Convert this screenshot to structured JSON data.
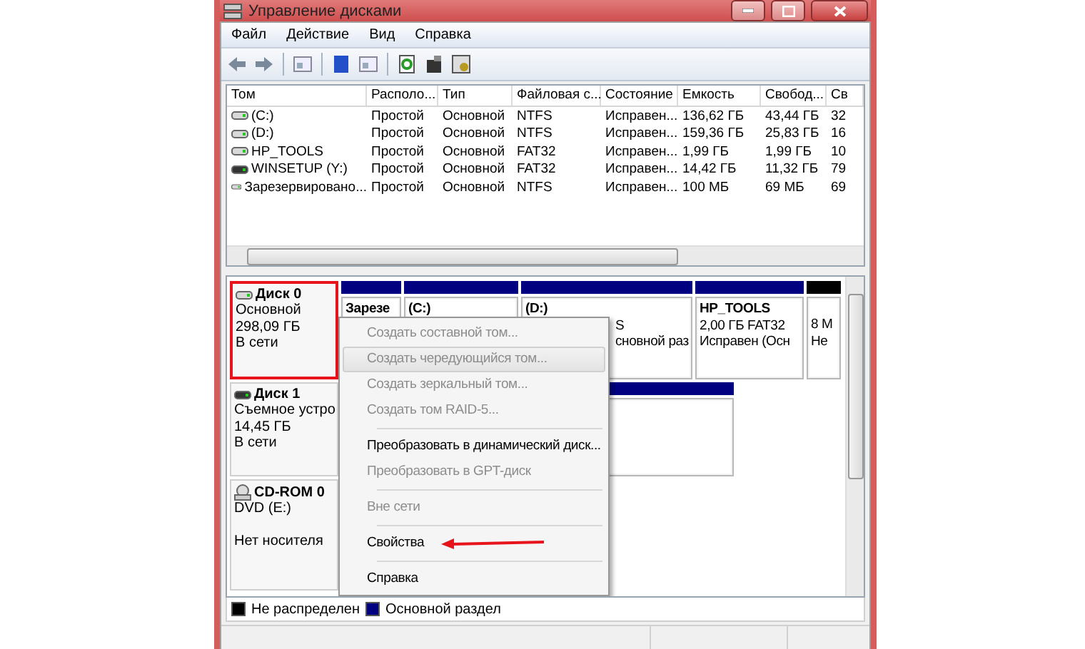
{
  "window": {
    "title": "Управление дисками"
  },
  "menu": [
    "Файл",
    "Действие",
    "Вид",
    "Справка"
  ],
  "table": {
    "columns": [
      "Том",
      "Располо...",
      "Тип",
      "Файловая с...",
      "Состояние",
      "Емкость",
      "Свобод...",
      "Св"
    ],
    "rows": [
      {
        "kind": "disk",
        "cells": [
          "(C:)",
          "Простой",
          "Основной",
          "NTFS",
          "Исправен...",
          "136,62 ГБ",
          "43,44 ГБ",
          "32"
        ]
      },
      {
        "kind": "disk",
        "cells": [
          "(D:)",
          "Простой",
          "Основной",
          "NTFS",
          "Исправен...",
          "159,36 ГБ",
          "25,83 ГБ",
          "16"
        ]
      },
      {
        "kind": "disk",
        "cells": [
          "HP_TOOLS",
          "Простой",
          "Основной",
          "FAT32",
          "Исправен...",
          "1,99 ГБ",
          "1,99 ГБ",
          "10"
        ]
      },
      {
        "kind": "removable",
        "cells": [
          "WINSETUP (Y:)",
          "Простой",
          "Основной",
          "FAT32",
          "Исправен...",
          "14,42 ГБ",
          "11,32 ГБ",
          "79"
        ]
      },
      {
        "kind": "disk",
        "cells": [
          "Зарезервировано...",
          "Простой",
          "Основной",
          "NTFS",
          "Исправен...",
          "100 МБ",
          "69 МБ",
          "69"
        ]
      }
    ]
  },
  "disks": [
    {
      "kind": "disk",
      "name": "Диск 0",
      "details": [
        "Основной",
        "298,09 ГБ"
      ],
      "status": "В сети",
      "highlighted": true,
      "partitions": [
        {
          "kind": "primary",
          "lines": [
            {
              "text": "Зарезе",
              "covered": false
            }
          ]
        },
        {
          "kind": "primary",
          "lines": [
            {
              "text": "(C:)",
              "covered": false
            }
          ]
        },
        {
          "kind": "primary",
          "lines": [
            {
              "text": "(D:)",
              "covered": false
            },
            {
              "text": "S",
              "covered": true
            },
            {
              "text": "сновной раз",
              "covered": true
            }
          ]
        },
        {
          "kind": "primary",
          "lines": [
            {
              "text": "HP_TOOLS",
              "covered": false
            },
            {
              "text": "2,00 ГБ FAT32",
              "covered": false
            },
            {
              "text": "Исправен (Осн",
              "covered": false
            }
          ]
        },
        {
          "kind": "unallocated",
          "lines": [
            {
              "text": "8 М",
              "covered": false
            },
            {
              "text": "Не",
              "covered": false
            }
          ]
        }
      ]
    },
    {
      "kind": "removable",
      "name": "Диск 1",
      "details": [
        "Съемное устро",
        "14,45 ГБ"
      ],
      "status": "В сети",
      "highlighted": false,
      "partitions": [
        {
          "kind": "primary"
        }
      ]
    },
    {
      "kind": "cdrom",
      "name": "CD-ROM 0",
      "details": [
        "DVD (E:)"
      ],
      "status": "Нет носителя",
      "highlighted": false
    }
  ],
  "context_menu": {
    "sections": [
      [
        {
          "label": "Создать составной том...",
          "disabled": true,
          "highlighted": false
        },
        {
          "label": "Создать чередующийся том...",
          "disabled": true,
          "highlighted": true
        },
        {
          "label": "Создать зеркальный том...",
          "disabled": true,
          "highlighted": false
        },
        {
          "label": "Создать том RAID-5...",
          "disabled": true,
          "highlighted": false
        }
      ],
      [
        {
          "label": "Преобразовать в динамический диск...",
          "disabled": false,
          "highlighted": false
        },
        {
          "label": "Преобразовать в GPT-диск",
          "disabled": true,
          "highlighted": false
        }
      ],
      [
        {
          "label": "Вне сети",
          "disabled": true,
          "highlighted": false
        }
      ],
      [
        {
          "label": "Свойства",
          "disabled": false,
          "highlighted": false
        }
      ],
      [
        {
          "label": "Справка",
          "disabled": false,
          "highlighted": false
        }
      ]
    ]
  },
  "legend": [
    {
      "label": "Не распределен",
      "color": "#000000"
    },
    {
      "label": "Основной раздел",
      "color": "#000080"
    }
  ]
}
